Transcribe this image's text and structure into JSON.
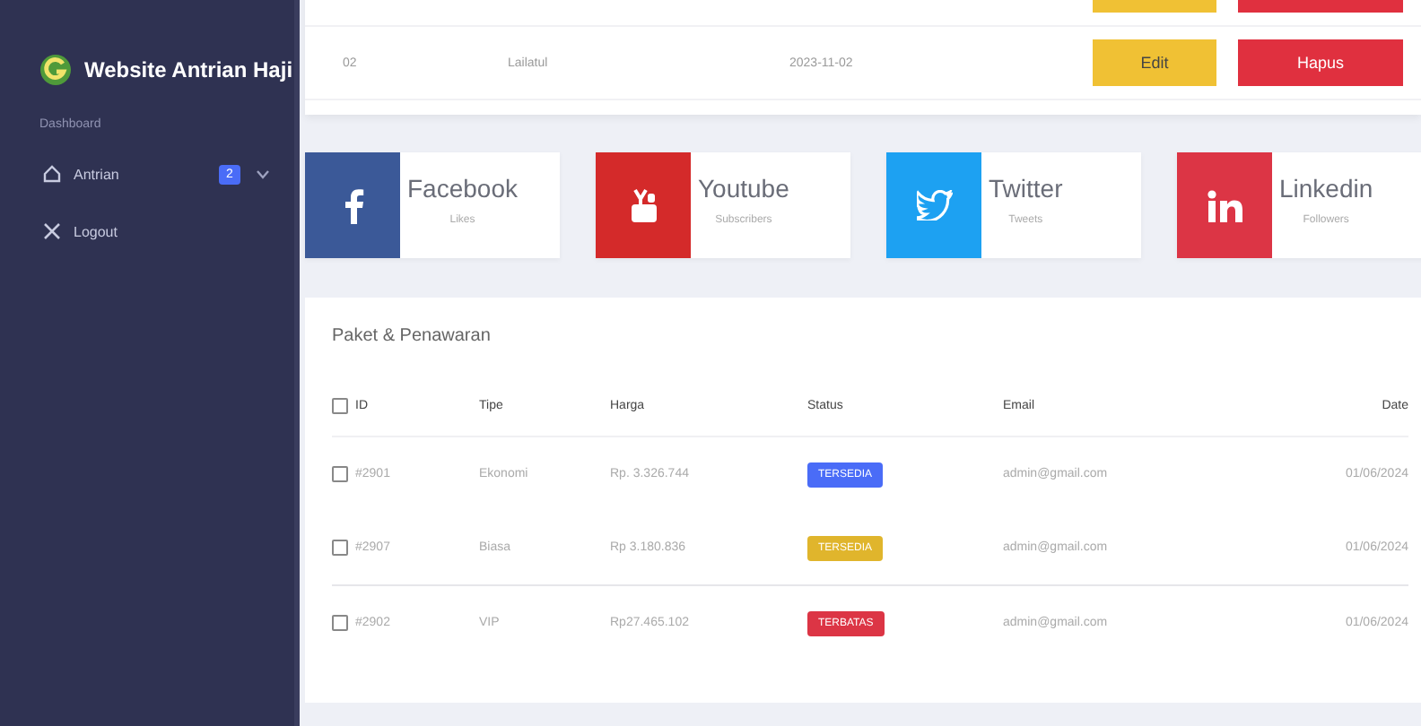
{
  "sidebar": {
    "title": "Website Antrian Haji",
    "section": "Dashboard",
    "items": [
      {
        "label": "Antrian",
        "kind": "home",
        "badge": "2",
        "expandable": true
      },
      {
        "label": "Logout",
        "kind": "close",
        "expandable": false
      }
    ]
  },
  "top_table": {
    "rows": [
      {
        "kind": "clipped"
      },
      {
        "kind": "full",
        "no": "02",
        "name": "Lailatul",
        "date": "2023-11-02",
        "actions": [
          "Edit",
          "Hapus"
        ]
      }
    ]
  },
  "social": [
    {
      "name": "Facebook",
      "caption": "Likes",
      "kind": "facebook",
      "color": "#3b5998"
    },
    {
      "name": "Youtube",
      "caption": "Subscribers",
      "kind": "youtube",
      "color": "#d42a2a"
    },
    {
      "name": "Twitter",
      "caption": "Tweets",
      "kind": "twitter",
      "color": "#1da1f2"
    },
    {
      "name": "Linkedin",
      "caption": "Followers",
      "kind": "linkedin",
      "color": "#dc3545"
    }
  ],
  "table": {
    "title": "Paket & Penawaran",
    "select_all": {
      "checked": false
    },
    "columns": [
      "ID",
      "Tipe",
      "Harga",
      "Status",
      "Email",
      "Date"
    ],
    "rows": [
      {
        "checked": false,
        "id": "#2901",
        "type": "Ekonomi",
        "price": "Rp. 3.326.744",
        "status": "TERSEDIA",
        "color": "#4a6cf7",
        "email": "admin@gmail.com",
        "date": "01/06/2024"
      },
      {
        "checked": false,
        "id": "#2907",
        "type": "Biasa",
        "price": "Rp 3.180.836",
        "status": "TERSEDIA",
        "color": "#e0b52c",
        "email": "admin@gmail.com",
        "date": "01/06/2024"
      },
      {
        "checked": false,
        "id": "#2902",
        "type": "VIP",
        "price": "Rp27.465.102",
        "status": "TERBATAS",
        "color": "#dc3545",
        "email": "admin@gmail.com",
        "date": "01/06/2024"
      }
    ]
  }
}
